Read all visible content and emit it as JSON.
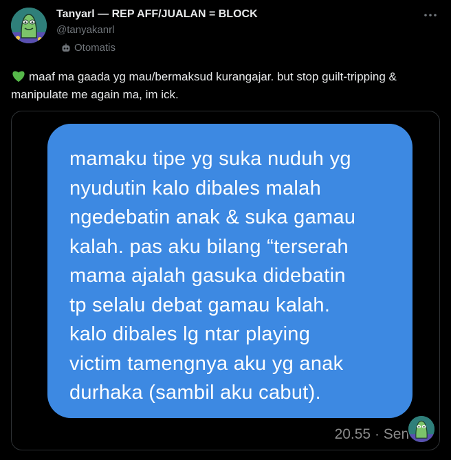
{
  "header": {
    "display_name": "Tanyarl — REP AFF/JUALAN = BLOCK",
    "handle": "@tanyakanrl",
    "automated_label": "Otomatis",
    "more_icon": "more-icon"
  },
  "tweet": {
    "emoji_icon": "green-heart-icon",
    "text": "maaf ma gaada yg mau/bermaksud kurangajar. but stop guilt-tripping & manipulate me again ma, im ick."
  },
  "media": {
    "message_text": "mamaku tipe yg suka nuduh yg\nnyudutin kalo dibales malah\nngedebatin anak & suka gamau\nkalah. pas aku bilang “terserah\nmama ajalah gasuka didebatin\ntp selalu debat gamau kalah.\nkalo dibales lg ntar playing\nvictim tamengnya aku yg anak\ndurhaka (sambil aku cabut).",
    "meta_time": "20.55",
    "meta_status": "Sent",
    "bubble_color": "#3d89e2"
  },
  "colors": {
    "background": "#000000",
    "text": "#e7e9ea",
    "muted": "#71767b",
    "avatar_teal": "#2f7f7a",
    "heart_green": "#56b84a"
  }
}
